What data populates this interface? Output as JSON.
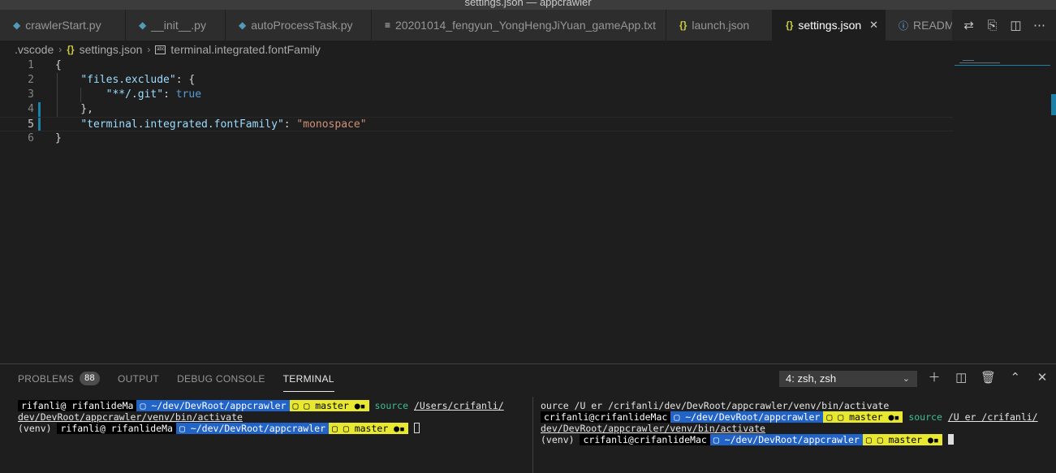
{
  "window": {
    "title": "settings.json — appcrawler"
  },
  "tabs": [
    {
      "label": "crawlerStart.py",
      "icon": "python-icon"
    },
    {
      "label": "__init__.py",
      "icon": "python-icon"
    },
    {
      "label": "autoProcessTask.py",
      "icon": "python-icon"
    },
    {
      "label": "20201014_fengyun_YongHengJiYuan_gameApp.txt",
      "icon": "text-file-icon"
    },
    {
      "label": "launch.json",
      "icon": "json-icon"
    },
    {
      "label": "settings.json",
      "icon": "json-icon",
      "active": true
    },
    {
      "label": "READM",
      "icon": "info-icon"
    }
  ],
  "breadcrumb": {
    "folder": ".vscode",
    "file": "settings.json",
    "symbol": "terminal.integrated.fontFamily"
  },
  "editor": {
    "lines": [
      {
        "n": "1",
        "tokens": [
          [
            "p",
            "{"
          ]
        ]
      },
      {
        "n": "2",
        "tokens": [
          [
            "p",
            "    "
          ],
          [
            "k",
            "\"files.exclude\""
          ],
          [
            "p",
            ": {"
          ]
        ]
      },
      {
        "n": "3",
        "tokens": [
          [
            "p",
            "        "
          ],
          [
            "k",
            "\"**/.git\""
          ],
          [
            "p",
            ": "
          ],
          [
            "b",
            "true"
          ]
        ]
      },
      {
        "n": "4",
        "tokens": [
          [
            "p",
            "    },"
          ]
        ]
      },
      {
        "n": "5",
        "tokens": [
          [
            "p",
            "    "
          ],
          [
            "k",
            "\"terminal.integrated.fontFamily\""
          ],
          [
            "p",
            ": "
          ],
          [
            "s",
            "\"monospace\""
          ]
        ]
      },
      {
        "n": "6",
        "tokens": [
          [
            "p",
            "}"
          ]
        ]
      }
    ],
    "active_line": "5"
  },
  "panel": {
    "tabs": [
      {
        "label": "PROBLEMS",
        "badge": "88"
      },
      {
        "label": "OUTPUT"
      },
      {
        "label": "DEBUG CONSOLE"
      },
      {
        "label": "TERMINAL",
        "active": true
      }
    ],
    "terminal_select": "4: zsh, zsh"
  },
  "terminal_left": {
    "line1": {
      "user": "rifanli@ rifanlideMa",
      "dir": "~/dev/DevRoot/appcrawler",
      "git": "master",
      "cmd": "source",
      "path": "/Users/crifanli/"
    },
    "line2": {
      "text": "dev/DevRoot/appcrawler/venv/bin/activate"
    },
    "line3": {
      "venv": "(venv)",
      "user": "rifanli@ rifanlideMa",
      "dir": "~/dev/DevRoot/appcrawler",
      "git": "master"
    }
  },
  "terminal_right": {
    "line1": {
      "text": "ource /U er /crifanli/dev/DevRoot/appcrawler/venv/bin/activate"
    },
    "line2": {
      "user": "crifanli@crifanlideMac",
      "dir": "~/dev/DevRoot/appcrawler",
      "git": "master",
      "cmd": "source",
      "path": "/U er /crifanli/"
    },
    "line3": {
      "text": "dev/DevRoot/appcrawler/venv/bin/activate"
    },
    "line4": {
      "venv": "(venv)",
      "user": "crifanli@crifanlideMac",
      "dir": "~/dev/DevRoot/appcrawler",
      "git": "master"
    }
  },
  "colors": {
    "editor_bg": "#1e1e1e",
    "tab_bar_bg": "#252526",
    "prompt_dir_bg": "#2163c6",
    "prompt_git_bg": "#e8e830",
    "json_key": "#9cdcfe",
    "json_string": "#ce9178",
    "json_bool": "#569cd6"
  }
}
